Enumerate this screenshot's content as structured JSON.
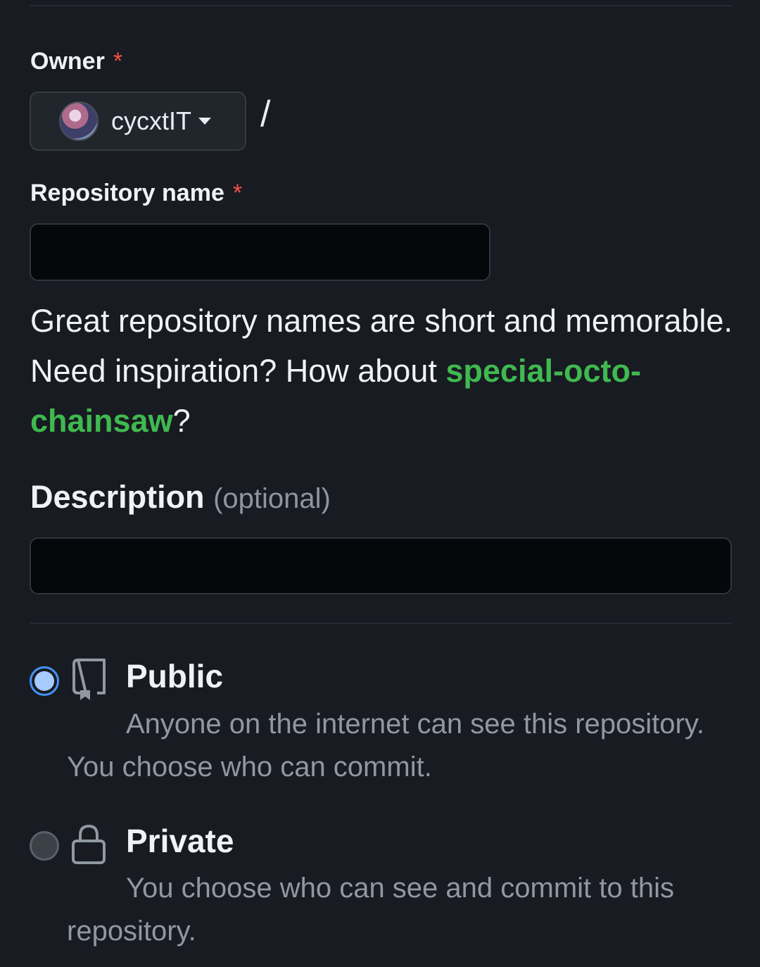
{
  "owner": {
    "label": "Owner",
    "required_mark": "*",
    "selected": "cycxtIT",
    "separator": "/"
  },
  "repo_name": {
    "label": "Repository name",
    "required_mark": "*",
    "value": ""
  },
  "hint": {
    "text_before": "Great repository names are short and memorable. Need inspiration? How about ",
    "suggestion": "special-octo-chainsaw",
    "text_after": "?"
  },
  "description": {
    "label": "Description",
    "optional_label": "(optional)",
    "value": ""
  },
  "visibility": {
    "selected": "public",
    "options": [
      {
        "id": "public",
        "title": "Public",
        "description": "Anyone on the internet can see this repository. You choose who can commit.",
        "icon": "repo-icon"
      },
      {
        "id": "private",
        "title": "Private",
        "description": "You choose who can see and commit to this repository.",
        "icon": "lock-icon"
      }
    ]
  },
  "colors": {
    "background": "#181b21",
    "required": "#f85149",
    "suggestion": "#3fb950",
    "radio_selected": "#4493f8"
  }
}
